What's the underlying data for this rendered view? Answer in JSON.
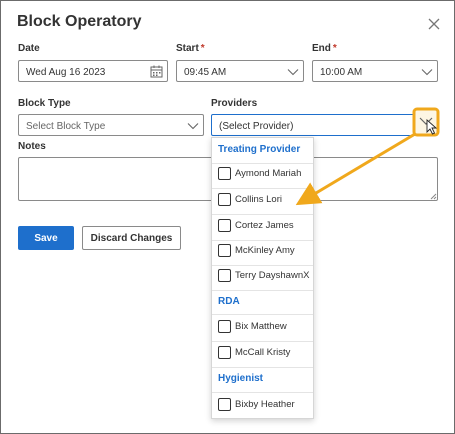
{
  "dialog": {
    "title": "Block Operatory",
    "date_label": "Date",
    "date_value": "Wed Aug 16 2023",
    "start_label": "Start",
    "start_value": "09:45 AM",
    "end_label": "End",
    "end_value": "10:00 AM",
    "required_mark": "*",
    "block_type_label": "Block Type",
    "block_type_placeholder": "Select Block Type",
    "providers_label": "Providers",
    "providers_placeholder": "(Select Provider)",
    "notes_label": "Notes",
    "save_label": "Save",
    "discard_label": "Discard Changes"
  },
  "provider_dropdown": {
    "groups": [
      {
        "name": "Treating Provider",
        "items": [
          "Aymond Mariah",
          "Collins Lori",
          "Cortez James",
          "McKinley Amy",
          "Terry DayshawnX"
        ]
      },
      {
        "name": "RDA",
        "items": [
          "Bix Matthew",
          "McCall Kristy"
        ]
      },
      {
        "name": "Hygienist",
        "items": [
          "Bixby Heather"
        ]
      }
    ]
  },
  "annotation": {
    "highlight_color": "#f0a81c"
  },
  "colors": {
    "accent": "#1e6fcc",
    "required": "#c0392b"
  }
}
